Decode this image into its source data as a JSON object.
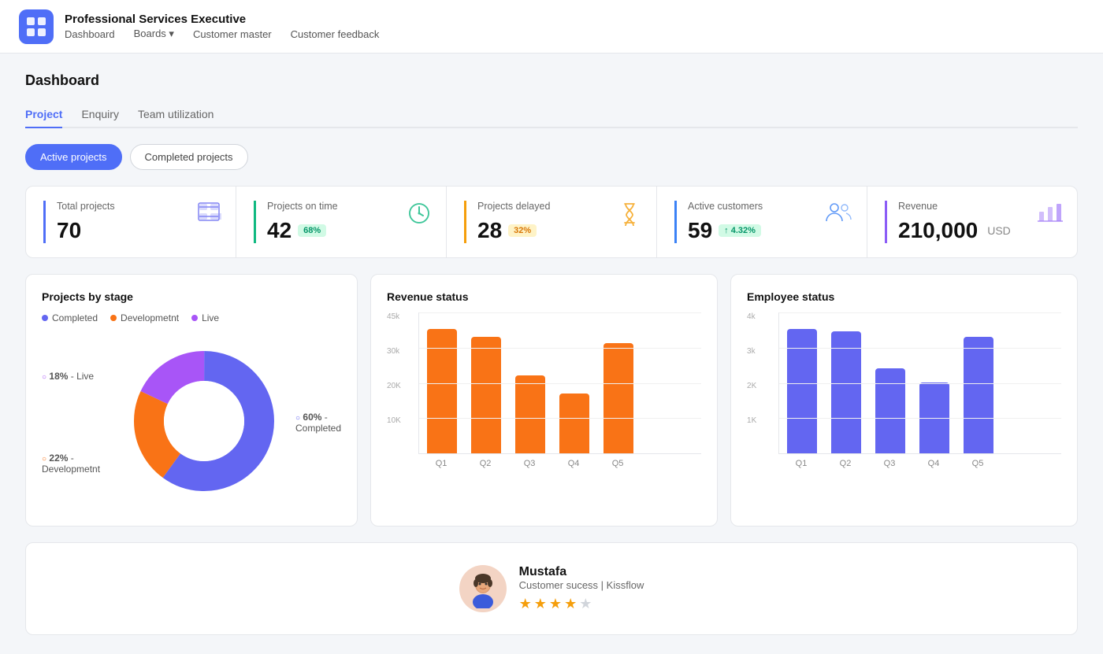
{
  "header": {
    "app_title": "Professional Services Executive",
    "logo_alt": "App Logo",
    "nav": [
      {
        "label": "Dashboard",
        "active": false
      },
      {
        "label": "Boards",
        "has_dropdown": true,
        "active": false
      },
      {
        "label": "Customer master",
        "active": false
      },
      {
        "label": "Customer feedback",
        "active": false
      }
    ]
  },
  "page": {
    "title": "Dashboard",
    "tabs": [
      {
        "label": "Project",
        "active": true
      },
      {
        "label": "Enquiry",
        "active": false
      },
      {
        "label": "Team utilization",
        "active": false
      }
    ],
    "toggle_buttons": [
      {
        "label": "Active projects",
        "active": true
      },
      {
        "label": "Completed projects",
        "active": false
      }
    ]
  },
  "stat_cards": [
    {
      "label": "Total projects",
      "value": "70",
      "badge": null,
      "border_color": "blue",
      "icon": "grid-icon"
    },
    {
      "label": "Projects on time",
      "value": "42",
      "badge": "68%",
      "badge_type": "green",
      "border_color": "green",
      "icon": "clock-icon"
    },
    {
      "label": "Projects delayed",
      "value": "28",
      "badge": "32%",
      "badge_type": "yellow",
      "border_color": "yellow",
      "icon": "hourglass-icon"
    },
    {
      "label": "Active customers",
      "value": "59",
      "badge": "↑ 4.32%",
      "badge_type": "up",
      "border_color": "blue2",
      "icon": "users-icon"
    },
    {
      "label": "Revenue",
      "value": "210,000",
      "value_suffix": "USD",
      "badge": null,
      "border_color": "purple",
      "icon": "bar-icon"
    }
  ],
  "projects_by_stage": {
    "title": "Projects by stage",
    "legend": [
      {
        "label": "Completed",
        "color": "#6366f1"
      },
      {
        "label": "Developmetnt",
        "color": "#f97316"
      },
      {
        "label": "Live",
        "color": "#a855f7"
      }
    ],
    "segments": [
      {
        "label": "Completed",
        "pct": 60,
        "color": "#6366f1"
      },
      {
        "label": "Developmetnt",
        "pct": 22,
        "color": "#f97316"
      },
      {
        "label": "Live",
        "pct": 18,
        "color": "#a855f7"
      }
    ]
  },
  "revenue_status": {
    "title": "Revenue status",
    "y_labels": [
      "45k",
      "30k",
      "20K",
      "10K",
      ""
    ],
    "bars": [
      {
        "label": "Q1",
        "height_pct": 88
      },
      {
        "label": "Q2",
        "height_pct": 82
      },
      {
        "label": "Q3",
        "height_pct": 55
      },
      {
        "label": "Q4",
        "height_pct": 42
      },
      {
        "label": "Q5",
        "height_pct": 78
      }
    ],
    "bar_color": "#f97316"
  },
  "employee_status": {
    "title": "Employee status",
    "y_labels": [
      "4k",
      "3k",
      "2K",
      "1K",
      ""
    ],
    "bars": [
      {
        "label": "Q1",
        "height_pct": 88
      },
      {
        "label": "Q2",
        "height_pct": 86
      },
      {
        "label": "Q3",
        "height_pct": 60
      },
      {
        "label": "Q4",
        "height_pct": 50
      },
      {
        "label": "Q5",
        "height_pct": 82
      }
    ],
    "bar_color": "#6366f1"
  },
  "customer": {
    "name": "Mustafa",
    "role": "Customer sucess | Kissflow",
    "stars": 4,
    "avatar_emoji": "🧑"
  }
}
